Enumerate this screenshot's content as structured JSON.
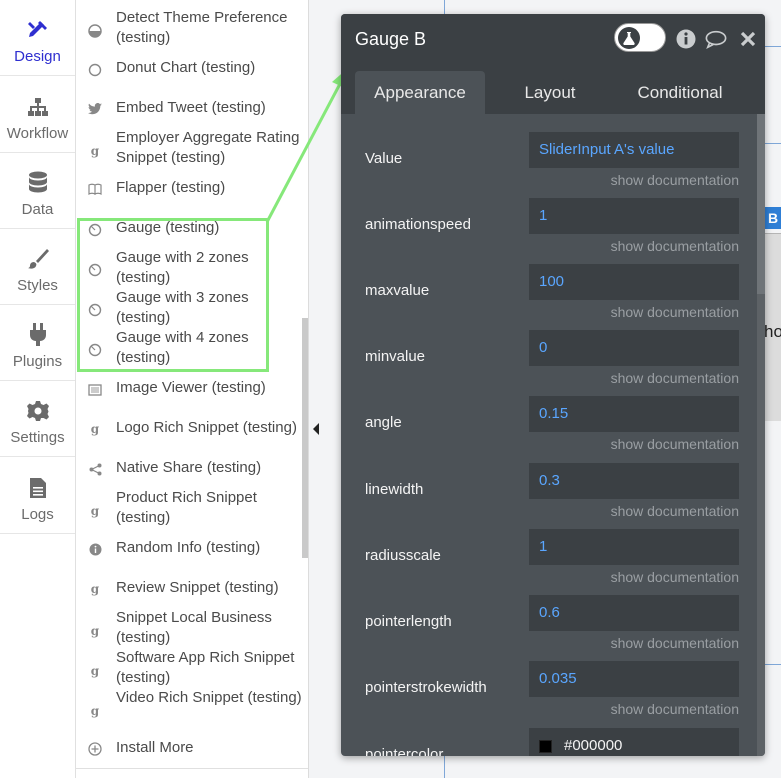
{
  "nav": {
    "items": [
      {
        "label": "Design",
        "icon": "design-icon"
      },
      {
        "label": "Workflow",
        "icon": "workflow-icon"
      },
      {
        "label": "Data",
        "icon": "data-icon"
      },
      {
        "label": "Styles",
        "icon": "brush-icon"
      },
      {
        "label": "Plugins",
        "icon": "plug-icon"
      },
      {
        "label": "Settings",
        "icon": "gear-icon"
      },
      {
        "label": "Logs",
        "icon": "logs-icon"
      }
    ]
  },
  "plugins": {
    "items": [
      {
        "label": "Detect Theme Preference (testing)",
        "icon": "theme-icon"
      },
      {
        "label": "Donut Chart (testing)",
        "icon": "circle-icon"
      },
      {
        "label": "Embed Tweet (testing)",
        "icon": "twitter-icon"
      },
      {
        "label": "Employer Aggregate Rating Snippet (testing)",
        "icon": "google-icon"
      },
      {
        "label": "Flapper (testing)",
        "icon": "book-icon"
      },
      {
        "label": "Gauge (testing)",
        "icon": "gauge-icon"
      },
      {
        "label": "Gauge with 2 zones (testing)",
        "icon": "gauge-icon"
      },
      {
        "label": "Gauge with 3 zones (testing)",
        "icon": "gauge-icon"
      },
      {
        "label": "Gauge with 4 zones (testing)",
        "icon": "gauge-icon"
      },
      {
        "label": "Image Viewer (testing)",
        "icon": "image-icon"
      },
      {
        "label": "Logo Rich Snippet (testing)",
        "icon": "google-icon"
      },
      {
        "label": "Native Share (testing)",
        "icon": "share-icon"
      },
      {
        "label": "Product Rich Snippet (testing)",
        "icon": "google-icon"
      },
      {
        "label": "Random Info (testing)",
        "icon": "info-icon"
      },
      {
        "label": "Review Snippet (testing)",
        "icon": "google-icon"
      },
      {
        "label": "Snippet Local Business (testing)",
        "icon": "google-icon"
      },
      {
        "label": "Software App Rich Snippet (testing)",
        "icon": "google-icon"
      },
      {
        "label": "Video Rich Snippet (testing)",
        "icon": "google-icon"
      },
      {
        "label": "Install More",
        "icon": "plus-circle-icon"
      }
    ]
  },
  "canvas": {
    "text": "ho",
    "badge": "B"
  },
  "editor": {
    "title": "Gauge B",
    "tabs": [
      {
        "label": "Appearance",
        "active": true
      },
      {
        "label": "Layout",
        "active": false
      },
      {
        "label": "Conditional",
        "active": false
      }
    ],
    "doc_link": "show documentation",
    "properties": [
      {
        "label": "Value",
        "value": "SliderInput A's value"
      },
      {
        "label": "animationspeed",
        "value": "1"
      },
      {
        "label": "maxvalue",
        "value": "100"
      },
      {
        "label": "minvalue",
        "value": "0"
      },
      {
        "label": "angle",
        "value": "0.15"
      },
      {
        "label": "linewidth",
        "value": "0.3"
      },
      {
        "label": "radiusscale",
        "value": "1"
      },
      {
        "label": "pointerlength",
        "value": "0.6"
      },
      {
        "label": "pointerstrokewidth",
        "value": "0.035"
      },
      {
        "label": "pointercolor",
        "value": "#000000",
        "swatch": "#000000"
      }
    ]
  },
  "colors": {
    "accent": "#2f2fd0",
    "highlight": "#86e87a",
    "value_text": "#5aa6ff"
  }
}
